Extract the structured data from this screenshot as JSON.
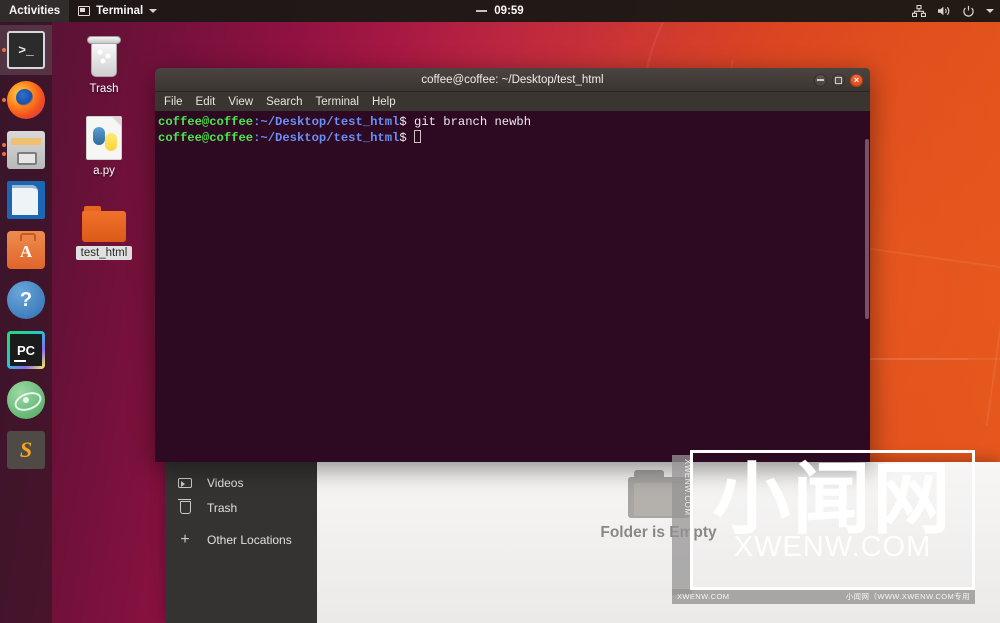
{
  "topbar": {
    "activities": "Activities",
    "app_name": "Terminal",
    "clock": "09:59",
    "icons": [
      "network-icon",
      "volume-icon",
      "power-icon",
      "chevron-down-icon"
    ]
  },
  "dock": {
    "items": [
      {
        "label": "Terminal",
        "icon": "terminal-icon",
        "running": 1,
        "active": true
      },
      {
        "label": "Firefox",
        "icon": "firefox-icon",
        "running": 1,
        "active": false
      },
      {
        "label": "Files",
        "icon": "files-icon",
        "running": 2,
        "active": false
      },
      {
        "label": "LibreOffice Writer",
        "icon": "writer-icon",
        "running": 0,
        "active": false
      },
      {
        "label": "Ubuntu Software",
        "icon": "software-icon",
        "running": 0,
        "active": false
      },
      {
        "label": "Help",
        "icon": "help-icon",
        "running": 0,
        "active": false
      },
      {
        "label": "PyCharm",
        "icon": "pycharm-icon",
        "running": 0,
        "active": false
      },
      {
        "label": "Atom",
        "icon": "atom-icon",
        "running": 0,
        "active": false
      },
      {
        "label": "Sublime Text",
        "icon": "sublime-icon",
        "running": 0,
        "active": false
      }
    ]
  },
  "desktop": {
    "icons": [
      {
        "label": "Trash",
        "type": "trash-icon",
        "selected": false
      },
      {
        "label": "a.py",
        "type": "python-file-icon",
        "selected": false
      },
      {
        "label": "test_html",
        "type": "folder-icon",
        "selected": true
      }
    ]
  },
  "terminal": {
    "title": "coffee@coffee: ~/Desktop/test_html",
    "menu": [
      "File",
      "Edit",
      "View",
      "Search",
      "Terminal",
      "Help"
    ],
    "window_buttons": [
      "minimize-button",
      "maximize-button",
      "close-button"
    ],
    "close_glyph": "×",
    "lines": [
      {
        "user": "coffee@coffee",
        "sep": ":",
        "path": "~/Desktop/test_html",
        "dollar": "$",
        "command": " git branch newbh"
      },
      {
        "user": "coffee@coffee",
        "sep": ":",
        "path": "~/Desktop/test_html",
        "dollar": "$",
        "command": " "
      }
    ]
  },
  "files": {
    "sidebar": [
      {
        "label": "Videos",
        "icon": "video-icon"
      },
      {
        "label": "Trash",
        "icon": "trash-icon"
      },
      {
        "label": "Other Locations",
        "icon": "plus-icon"
      }
    ],
    "empty_message": "Folder is Empty"
  },
  "watermark": {
    "cn": "小闻网",
    "en": "XWENW.COM",
    "vertical": "XWENW.COM",
    "bar_left": "XWENW.COM",
    "bar_right": "小闻网（WWW.XWENW.COM专用"
  },
  "colors": {
    "accent_orange": "#e8713c",
    "terminal_bg": "#2d0922",
    "topbar_bg": "#1d1916",
    "prompt_user": "#4ee44e",
    "prompt_path": "#6a8ff7"
  }
}
